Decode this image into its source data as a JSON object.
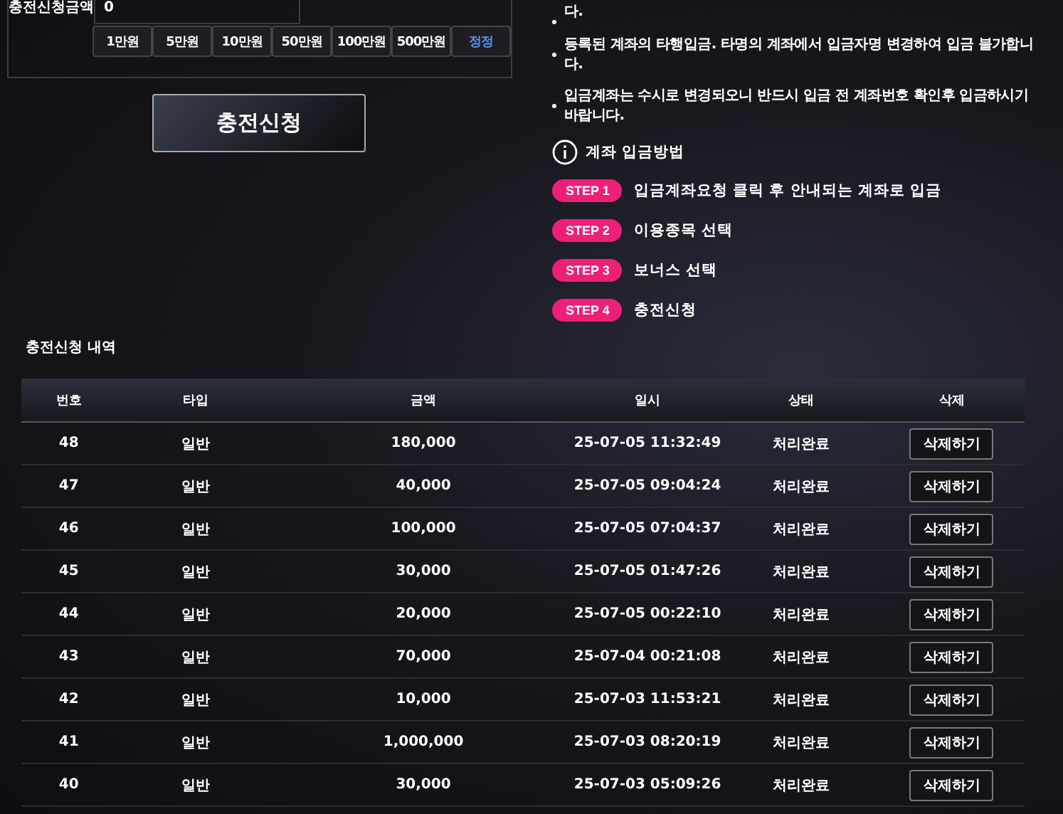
{
  "charge_form": {
    "amount_label": "충전신청금액",
    "amount_value": "0",
    "quick_amounts": [
      "1만원",
      "5만원",
      "10만원",
      "50만원",
      "100만원",
      "500만원"
    ],
    "reset_button": "정정",
    "submit_button": "충전신청"
  },
  "notes": [
    "다.",
    "등록된 계좌의 타행입금. 타명의 계좌에서 입금자명 변경하여 입금 불가합니다.",
    "입금계좌는 수시로 변경되오니 반드시 입금 전 계좌번호 확인후 입금하시기 바랍니다."
  ],
  "guide": {
    "title": "계좌 입금방법",
    "steps": [
      {
        "badge": "STEP 1",
        "text": "입금계좌요청 클릭 후 안내되는 계좌로 입금"
      },
      {
        "badge": "STEP 2",
        "text": "이용종목 선택"
      },
      {
        "badge": "STEP 3",
        "text": "보너스 선택"
      },
      {
        "badge": "STEP 4",
        "text": "충전신청"
      }
    ]
  },
  "history": {
    "title": "충전신청 내역",
    "columns": [
      "번호",
      "타입",
      "금액",
      "일시",
      "상태",
      "삭제"
    ],
    "rows": [
      {
        "no": "48",
        "type": "일반",
        "amount": "180,000",
        "datetime": "25-07-05 11:32:49",
        "status": "처리완료",
        "action": "삭제하기"
      },
      {
        "no": "47",
        "type": "일반",
        "amount": "40,000",
        "datetime": "25-07-05 09:04:24",
        "status": "처리완료",
        "action": "삭제하기"
      },
      {
        "no": "46",
        "type": "일반",
        "amount": "100,000",
        "datetime": "25-07-05 07:04:37",
        "status": "처리완료",
        "action": "삭제하기"
      },
      {
        "no": "45",
        "type": "일반",
        "amount": "30,000",
        "datetime": "25-07-05 01:47:26",
        "status": "처리완료",
        "action": "삭제하기"
      },
      {
        "no": "44",
        "type": "일반",
        "amount": "20,000",
        "datetime": "25-07-05 00:22:10",
        "status": "처리완료",
        "action": "삭제하기"
      },
      {
        "no": "43",
        "type": "일반",
        "amount": "70,000",
        "datetime": "25-07-04 00:21:08",
        "status": "처리완료",
        "action": "삭제하기"
      },
      {
        "no": "42",
        "type": "일반",
        "amount": "10,000",
        "datetime": "25-07-03 11:53:21",
        "status": "처리완료",
        "action": "삭제하기"
      },
      {
        "no": "41",
        "type": "일반",
        "amount": "1,000,000",
        "datetime": "25-07-03 08:20:19",
        "status": "처리완료",
        "action": "삭제하기"
      },
      {
        "no": "40",
        "type": "일반",
        "amount": "30,000",
        "datetime": "25-07-03 05:09:26",
        "status": "처리완료",
        "action": "삭제하기"
      }
    ]
  }
}
